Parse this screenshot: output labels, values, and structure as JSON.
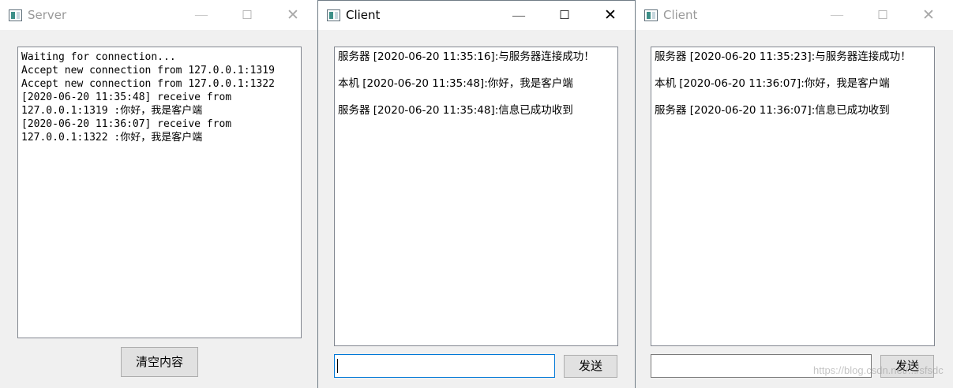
{
  "server": {
    "title": "Server",
    "controls": {
      "minimize": "—",
      "maximize": "☐",
      "close": "✕"
    },
    "log": [
      "Waiting for connection...",
      "Accept new connection from 127.0.0.1:1319",
      "Accept new connection from 127.0.0.1:1322",
      "[2020-06-20 11:35:48] receive from",
      "127.0.0.1:1319 :你好，我是客户端",
      "[2020-06-20 11:36:07] receive from",
      "127.0.0.1:1322 :你好，我是客户端"
    ],
    "clear_button": "清空内容"
  },
  "client1": {
    "title": "Client",
    "controls": {
      "minimize": "—",
      "maximize": "☐",
      "close": "✕"
    },
    "messages": [
      "服务器 [2020-06-20 11:35:16]:与服务器连接成功！",
      "本机 [2020-06-20 11:35:48]:你好，我是客户端",
      "服务器 [2020-06-20 11:35:48]:信息已成功收到"
    ],
    "input_value": "",
    "send_button": "发送"
  },
  "client2": {
    "title": "Client",
    "controls": {
      "minimize": "—",
      "maximize": "☐",
      "close": "✕"
    },
    "messages": [
      "服务器 [2020-06-20 11:35:23]:与服务器连接成功！",
      "本机 [2020-06-20 11:36:07]:你好，我是客户端",
      "服务器 [2020-06-20 11:36:07]:信息已成功收到"
    ],
    "input_value": "",
    "send_button": "发送"
  },
  "watermark": "https://blog.csdn.net/.../sfsdc",
  "colors": {
    "window_bg": "#f0f0f0",
    "focus_border": "#0078d7",
    "inactive_title": "#999999"
  }
}
